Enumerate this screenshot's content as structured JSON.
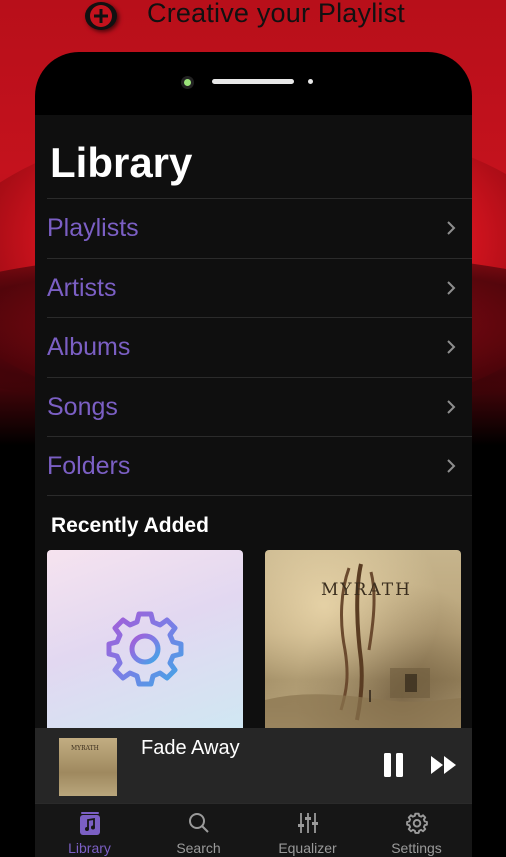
{
  "promo": {
    "title": "Creative your Playlist",
    "badge_icon": "plus-circle-icon",
    "accent_color": "#c4121d"
  },
  "library": {
    "title": "Library",
    "menu": [
      {
        "label": "Playlists",
        "icon": "chevron-right-icon"
      },
      {
        "label": "Artists",
        "icon": "chevron-right-icon"
      },
      {
        "label": "Albums",
        "icon": "chevron-right-icon"
      },
      {
        "label": "Songs",
        "icon": "chevron-right-icon"
      },
      {
        "label": "Folders",
        "icon": "chevron-right-icon"
      }
    ],
    "menu_color": "#7b5fc4",
    "recently_added": {
      "title": "Recently Added",
      "items": [
        {
          "icon": "gear-icon"
        },
        {
          "album_text": "MYRATH"
        }
      ]
    }
  },
  "now_playing": {
    "title": "Fade Away",
    "art_text": "MYRATH",
    "pause_icon": "pause-icon",
    "next_icon": "fast-forward-icon"
  },
  "tabbar": {
    "tabs": [
      {
        "label": "Library",
        "icon": "music-note-icon",
        "active": true
      },
      {
        "label": "Search",
        "icon": "search-icon",
        "active": false
      },
      {
        "label": "Equalizer",
        "icon": "equalizer-icon",
        "active": false
      },
      {
        "label": "Settings",
        "icon": "gear-icon",
        "active": false
      }
    ],
    "active_color": "#7b5fc4"
  }
}
